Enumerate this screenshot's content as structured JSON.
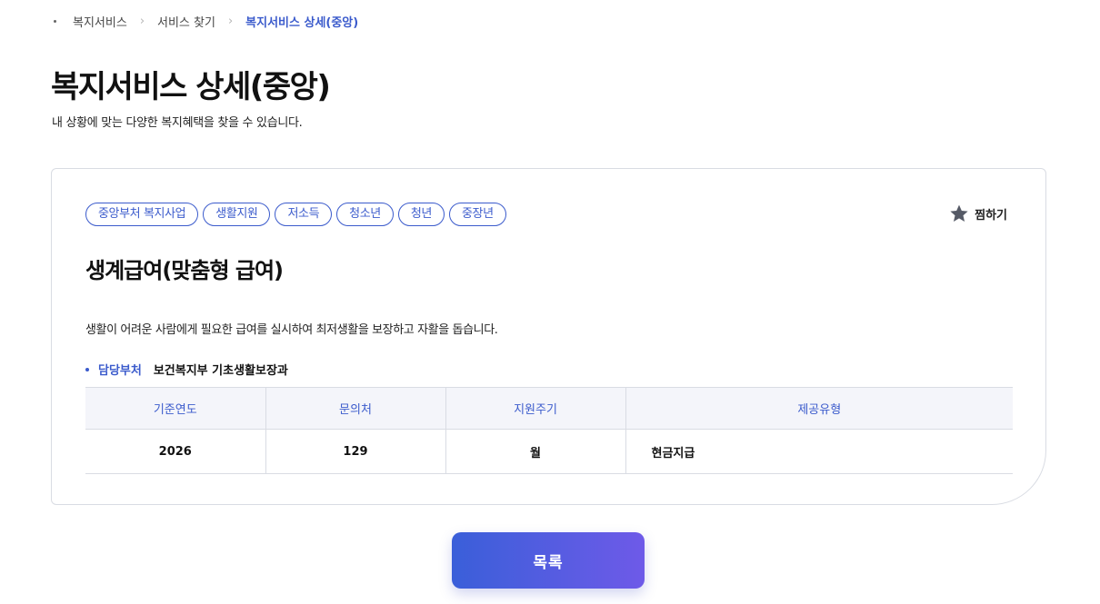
{
  "breadcrumb": {
    "items": [
      "복지서비스",
      "서비스 찾기",
      "복지서비스 상세(중앙)"
    ]
  },
  "header": {
    "title": "복지서비스 상세(중앙)",
    "description": "내 상황에 맞는 다양한 복지혜택을 찾을 수 있습니다."
  },
  "service": {
    "tags": [
      "중앙부처 복지사업",
      "생활지원",
      "저소득",
      "청소년",
      "청년",
      "중장년"
    ],
    "bookmark_label": "찜하기",
    "bookmark_icon": "star-icon",
    "title": "생계급여(맞춤형 급여)",
    "description": "생활이 어려운 사람에게 필요한 급여를 실시하여 최저생활을 보장하고 자활을 돕습니다.",
    "department_label": "담당부처",
    "department_value": "보건복지부 기초생활보장과",
    "table": {
      "headers": [
        "기준연도",
        "문의처",
        "지원주기",
        "제공유형"
      ],
      "row": [
        "2026",
        "129",
        "월",
        "현금지급"
      ]
    }
  },
  "footer": {
    "list_button_label": "목록"
  },
  "colors": {
    "accent": "#3b5bcc",
    "button_gradient_start": "#3a5fd9",
    "button_gradient_end": "#6e5ae8"
  }
}
